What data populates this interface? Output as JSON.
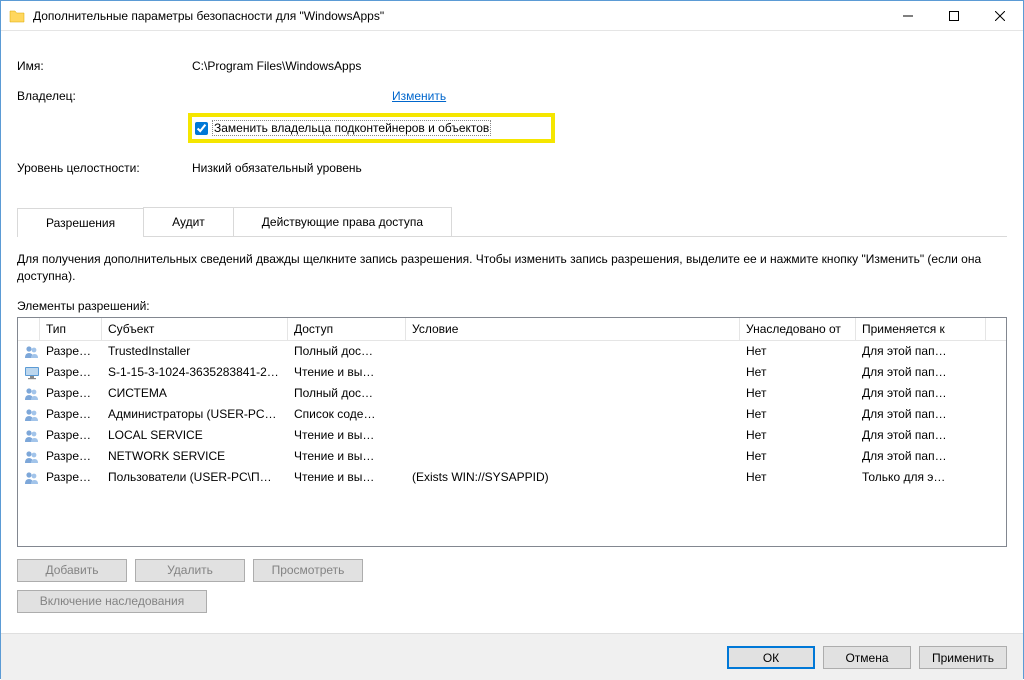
{
  "titlebar": {
    "title": "Дополнительные параметры безопасности  для \"WindowsApps\""
  },
  "info": {
    "name_label": "Имя:",
    "name_value": "C:\\Program Files\\WindowsApps",
    "owner_label": "Владелец:",
    "change_link": "Изменить",
    "replace_owner_label": "Заменить владельца подконтейнеров и объектов",
    "integrity_label": "Уровень целостности:",
    "integrity_value": "Низкий обязательный уровень"
  },
  "tabs": {
    "permissions": "Разрешения",
    "audit": "Аудит",
    "effective": "Действующие права доступа"
  },
  "permissions_panel": {
    "help": "Для получения дополнительных сведений дважды щелкните запись разрешения. Чтобы изменить запись разрешения, выделите ее и нажмите кнопку \"Изменить\" (если она доступна).",
    "elements_label": "Элементы разрешений:",
    "columns": {
      "type": "Тип",
      "subject": "Субъект",
      "access": "Доступ",
      "condition": "Условие",
      "inherited": "Унаследовано от",
      "applies": "Применяется к"
    },
    "rows": [
      {
        "icon": "group",
        "type": "Разре…",
        "subject": "TrustedInstaller",
        "access": "Полный дос…",
        "condition": "",
        "inherited": "Нет",
        "applies": "Для этой пап…"
      },
      {
        "icon": "monitor",
        "type": "Разре…",
        "subject": "S-1-15-3-1024-3635283841-2…",
        "access": "Чтение и вы…",
        "condition": "",
        "inherited": "Нет",
        "applies": "Для этой пап…"
      },
      {
        "icon": "group",
        "type": "Разре…",
        "subject": "СИСТЕМА",
        "access": "Полный дос…",
        "condition": "",
        "inherited": "Нет",
        "applies": "Для этой пап…"
      },
      {
        "icon": "group",
        "type": "Разре…",
        "subject": "Администраторы (USER-PC…",
        "access": "Список соде…",
        "condition": "",
        "inherited": "Нет",
        "applies": "Для этой пап…"
      },
      {
        "icon": "group",
        "type": "Разре…",
        "subject": "LOCAL SERVICE",
        "access": "Чтение и вы…",
        "condition": "",
        "inherited": "Нет",
        "applies": "Для этой пап…"
      },
      {
        "icon": "group",
        "type": "Разре…",
        "subject": "NETWORK SERVICE",
        "access": "Чтение и вы…",
        "condition": "",
        "inherited": "Нет",
        "applies": "Для этой пап…"
      },
      {
        "icon": "group",
        "type": "Разре…",
        "subject": "Пользователи (USER-PC\\П…",
        "access": "Чтение и вы…",
        "condition": "(Exists WIN://SYSAPPID)",
        "inherited": "Нет",
        "applies": "Только для э…"
      }
    ],
    "buttons": {
      "add": "Добавить",
      "remove": "Удалить",
      "view": "Просмотреть",
      "inherit": "Включение наследования"
    }
  },
  "footer": {
    "ok": "ОК",
    "cancel": "Отмена",
    "apply": "Применить"
  }
}
